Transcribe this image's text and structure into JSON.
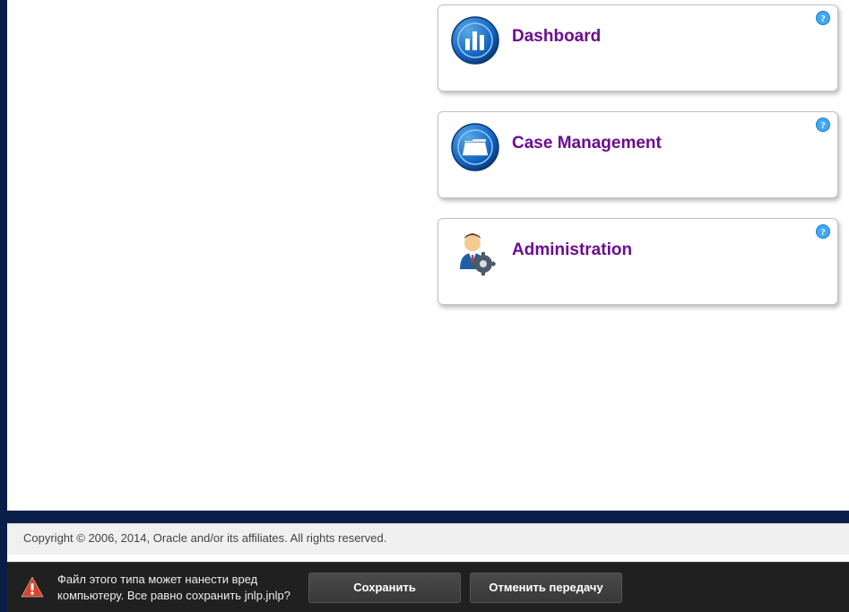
{
  "cards": [
    {
      "title": "Dashboard",
      "icon": "chart-icon"
    },
    {
      "title": "Case Management",
      "icon": "folder-icon"
    },
    {
      "title": "Administration",
      "icon": "user-gear-icon"
    }
  ],
  "footer": {
    "copyright": "Copyright © 2006, 2014, Oracle and/or its affiliates. All rights reserved."
  },
  "download_bar": {
    "warning_line1": "Файл этого типа может нанести вред",
    "warning_line2": "компьютеру. Все равно сохранить jnlp.jnlp?",
    "save_label": "Сохранить",
    "cancel_label": "Отменить передачу"
  }
}
